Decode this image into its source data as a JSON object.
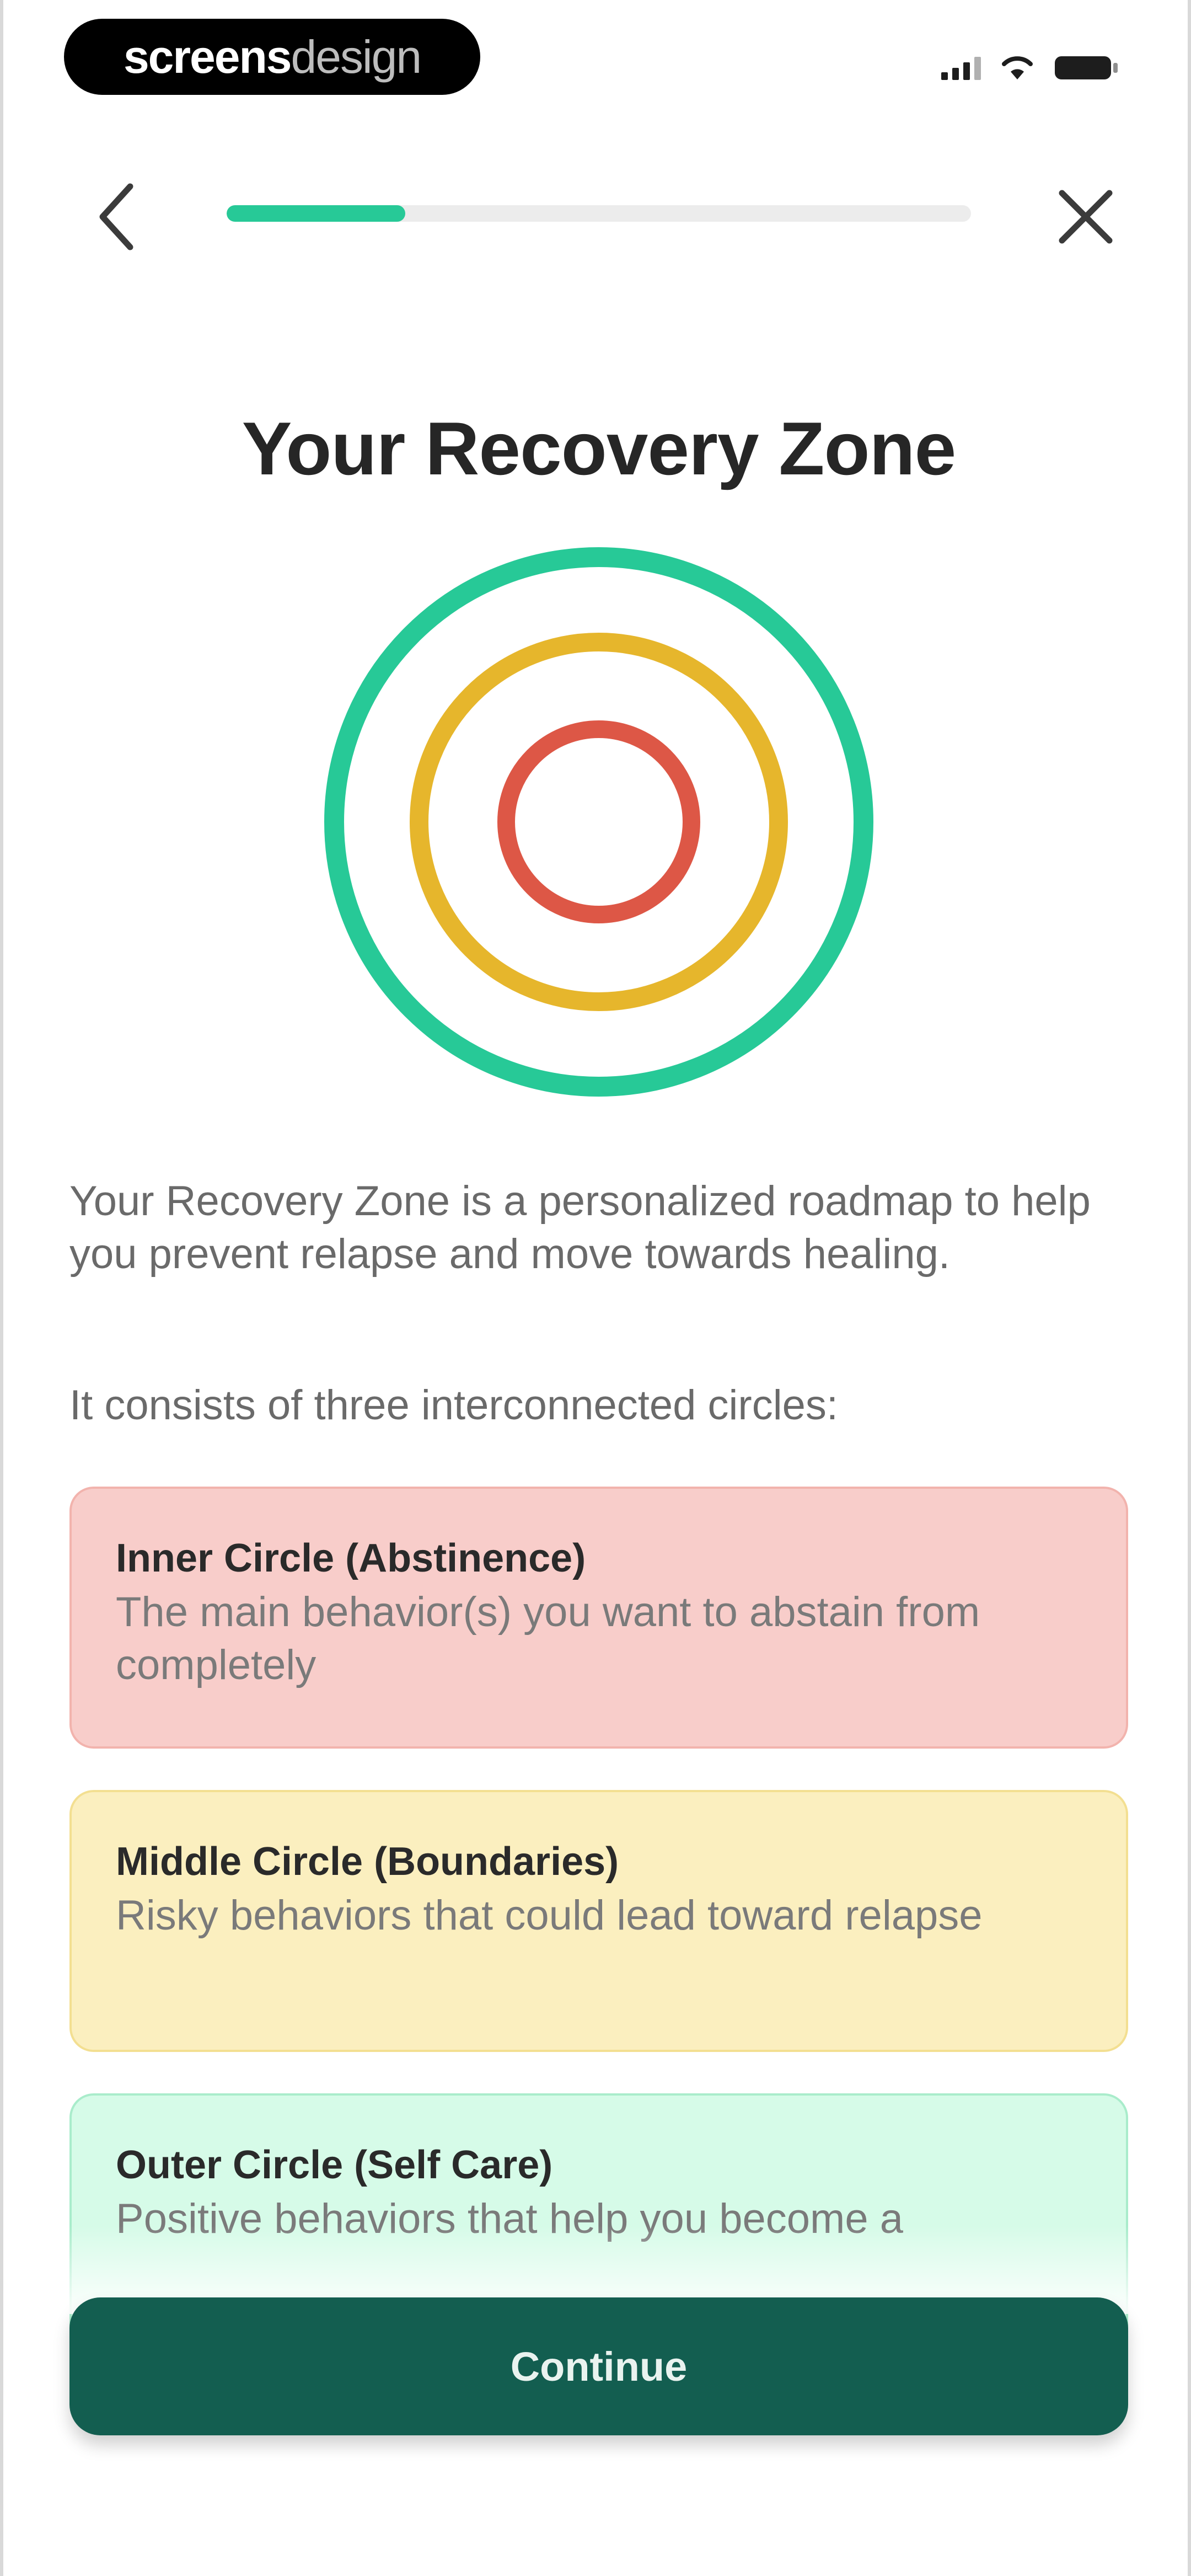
{
  "status_bar": {
    "watermark_bold": "screens",
    "watermark_light": "design",
    "icons": [
      "signal-icon",
      "wifi-icon",
      "battery-icon"
    ]
  },
  "nav": {
    "back_icon": "chevron-left-icon",
    "close_icon": "close-icon",
    "progress_fraction": 0.24,
    "progress_color": "#27c997"
  },
  "page": {
    "title": "Your Recovery Zone",
    "intro": "Your Recovery Zone is a personalized roadmap to help you prevent relapse and move towards healing.",
    "intro2": "It consists of three interconnected circles:"
  },
  "rings": {
    "outer_color": "#27c997",
    "middle_color": "#e6b62c",
    "inner_color": "#dd5746"
  },
  "cards": [
    {
      "title": "Inner Circle (Abstinence)",
      "desc": "The main behavior(s) you want to abstain from completely",
      "color": "#f8cdca"
    },
    {
      "title": "Middle Circle (Boundaries)",
      "desc": "Risky behaviors that could lead toward relapse",
      "color": "#fbefbf"
    },
    {
      "title": "Outer Circle (Self Care)",
      "desc": "Positive behaviors that help you become a",
      "color": "#d6fbe8"
    }
  ],
  "footer": {
    "continue_label": "Continue",
    "button_color": "#135e50"
  }
}
